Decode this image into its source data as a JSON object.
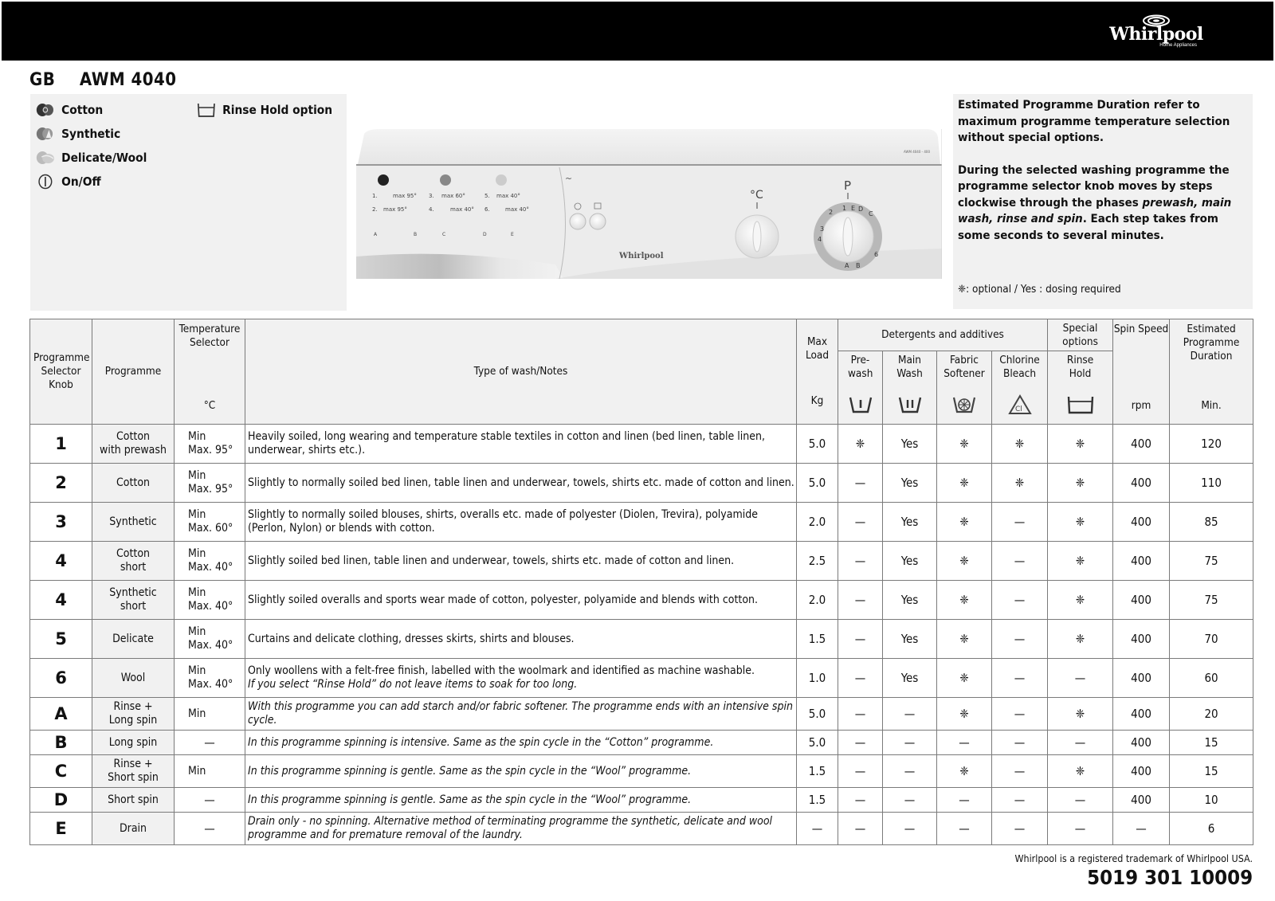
{
  "header": {
    "brand": "Whirlpool",
    "brand_sub": "Home Appliances",
    "region": "GB",
    "model": "AWM 4040"
  },
  "legend": {
    "items": [
      {
        "icon": "cotton-icon",
        "label": "Cotton"
      },
      {
        "icon": "synthetic-icon",
        "label": "Synthetic"
      },
      {
        "icon": "delicate-wool-icon",
        "label": "Delicate/Wool"
      },
      {
        "icon": "power-icon",
        "label": "On/Off"
      },
      {
        "icon": "rinse-hold-icon",
        "label": "Rinse Hold option"
      }
    ]
  },
  "control_panel": {
    "program_labels": [
      "1.",
      "max 95°",
      "2.",
      "max 95°",
      "3.",
      "max 60°",
      "4.",
      "max 40°",
      "5.",
      "max 40°",
      "6.",
      "max 40°"
    ],
    "special_programs": [
      "A",
      "B",
      "C",
      "D",
      "E"
    ],
    "temp_knob_symbol": "°C",
    "prog_knob_symbol": "P",
    "model_badge": "AWM 4040 - 400",
    "brand": "Whirlpool"
  },
  "info": {
    "para1": "Estimated Programme Duration refer to maximum programme temperature selection without special options.",
    "para2_a": "During the selected washing programme the programme selector knob moves by steps clockwise through the phases ",
    "para2_italic": "prewash, main wash, rinse and spin",
    "para2_b": ". Each step takes from some seconds to several minutes.",
    "note_symbol": "❈",
    "note": ": optional / Yes : dosing required"
  },
  "table": {
    "headers": {
      "knob": "Programme Selector Knob",
      "programme": "Programme",
      "temp": "Temperature Selector",
      "temp_unit": "°C",
      "notes": "Type of wash/Notes",
      "load": "Max Load",
      "load_unit": "Kg",
      "detergents": "Detergents and additives",
      "prewash": "Pre-wash",
      "mainwash": "Main Wash",
      "softener": "Fabric Softener",
      "bleach": "Chlorine Bleach",
      "special": "Special options",
      "rinsehold": "Rinse Hold",
      "spin": "Spin Speed",
      "spin_unit": "rpm",
      "duration": "Estimated Programme Duration",
      "duration_unit": "Min."
    },
    "rows": [
      {
        "knob": "1",
        "prog1": "Cotton",
        "prog2": "with prewash",
        "t1": "Min",
        "t2": "Max. 95°",
        "note": "Heavily soiled, long wearing and temperature stable textiles in cotton and linen (bed linen, table linen, underwear, shirts etc.).",
        "note_it": "",
        "load": "5.0",
        "pre": "❈",
        "main": "Yes",
        "soft": "❈",
        "bleach": "❈",
        "rinse": "❈",
        "rpm": "400",
        "min": "120"
      },
      {
        "knob": "2",
        "prog1": "Cotton",
        "prog2": "",
        "t1": "Min",
        "t2": "Max. 95°",
        "note": "Slightly to normally soiled bed linen, table linen and underwear, towels, shirts etc. made of cotton and linen.",
        "note_it": "",
        "load": "5.0",
        "pre": "—",
        "main": "Yes",
        "soft": "❈",
        "bleach": "❈",
        "rinse": "❈",
        "rpm": "400",
        "min": "110"
      },
      {
        "knob": "3",
        "prog1": "Synthetic",
        "prog2": "",
        "t1": "Min",
        "t2": "Max. 60°",
        "note": "Slightly to normally soiled blouses, shirts, overalls etc. made of polyester (Diolen, Trevira), polyamide (Perlon, Nylon) or blends with cotton.",
        "note_it": "",
        "load": "2.0",
        "pre": "—",
        "main": "Yes",
        "soft": "❈",
        "bleach": "—",
        "rinse": "❈",
        "rpm": "400",
        "min": "85"
      },
      {
        "knob": "4",
        "prog1": "Cotton",
        "prog2": "short",
        "t1": "Min",
        "t2": "Max. 40°",
        "note": "Slightly soiled bed linen, table linen and underwear, towels, shirts etc. made of cotton and linen.",
        "note_it": "",
        "load": "2.5",
        "pre": "—",
        "main": "Yes",
        "soft": "❈",
        "bleach": "—",
        "rinse": "❈",
        "rpm": "400",
        "min": "75"
      },
      {
        "knob": "4",
        "prog1": "Synthetic",
        "prog2": "short",
        "t1": "Min",
        "t2": "Max. 40°",
        "note": "Slightly soiled overalls and sports wear made of cotton, polyester, polyamide and blends with cotton.",
        "note_it": "",
        "load": "2.0",
        "pre": "—",
        "main": "Yes",
        "soft": "❈",
        "bleach": "—",
        "rinse": "❈",
        "rpm": "400",
        "min": "75"
      },
      {
        "knob": "5",
        "prog1": "Delicate",
        "prog2": "",
        "t1": "Min",
        "t2": "Max. 40°",
        "note": "Curtains and delicate clothing, dresses skirts, shirts and blouses.",
        "note_it": "",
        "load": "1.5",
        "pre": "—",
        "main": "Yes",
        "soft": "❈",
        "bleach": "—",
        "rinse": "❈",
        "rpm": "400",
        "min": "70"
      },
      {
        "knob": "6",
        "prog1": "Wool",
        "prog2": "",
        "t1": "Min",
        "t2": "Max. 40°",
        "note": "Only woollens with a felt-free finish, labelled with the woolmark and identified as machine washable.",
        "note_it": "If you select “Rinse Hold” do not leave items to soak for too long.",
        "load": "1.0",
        "pre": "—",
        "main": "Yes",
        "soft": "❈",
        "bleach": "—",
        "rinse": "—",
        "rpm": "400",
        "min": "60"
      },
      {
        "knob": "A",
        "prog1": "Rinse +",
        "prog2": "Long spin",
        "t1": "Min",
        "t2": "",
        "note": "",
        "note_it": "With this programme you can add starch and/or fabric softener. The programme ends with an intensive spin cycle.",
        "load": "5.0",
        "pre": "—",
        "main": "—",
        "soft": "❈",
        "bleach": "—",
        "rinse": "❈",
        "rpm": "400",
        "min": "20"
      },
      {
        "knob": "B",
        "prog1": "Long spin",
        "prog2": "",
        "t1": "—",
        "t2": "",
        "note": "",
        "note_it": "In this programme spinning is intensive. Same as the spin cycle in the “Cotton” programme.",
        "load": "5.0",
        "pre": "—",
        "main": "—",
        "soft": "—",
        "bleach": "—",
        "rinse": "—",
        "rpm": "400",
        "min": "15"
      },
      {
        "knob": "C",
        "prog1": "Rinse +",
        "prog2": "Short spin",
        "t1": "Min",
        "t2": "",
        "note": "",
        "note_it": "In this programme spinning is gentle. Same as the spin cycle in the “Wool” programme.",
        "load": "1.5",
        "pre": "—",
        "main": "—",
        "soft": "❈",
        "bleach": "—",
        "rinse": "❈",
        "rpm": "400",
        "min": "15"
      },
      {
        "knob": "D",
        "prog1": "Short spin",
        "prog2": "",
        "t1": "—",
        "t2": "",
        "note": "",
        "note_it": "In this programme spinning is gentle. Same as the spin cycle in the “Wool” programme.",
        "load": "1.5",
        "pre": "—",
        "main": "—",
        "soft": "—",
        "bleach": "—",
        "rinse": "—",
        "rpm": "400",
        "min": "10"
      },
      {
        "knob": "E",
        "prog1": "Drain",
        "prog2": "",
        "t1": "—",
        "t2": "",
        "note": "",
        "note_it": "Drain only - no spinning. Alternative method of terminating programme the synthetic, delicate and wool programme and for premature removal of the laundry.",
        "load": "—",
        "pre": "—",
        "main": "—",
        "soft": "—",
        "bleach": "—",
        "rinse": "—",
        "rpm": "—",
        "min": "6"
      }
    ]
  },
  "footer": {
    "trademark": "Whirlpool is a registered trademark of Whirlpool USA.",
    "part_number": "5019 301 10009"
  }
}
